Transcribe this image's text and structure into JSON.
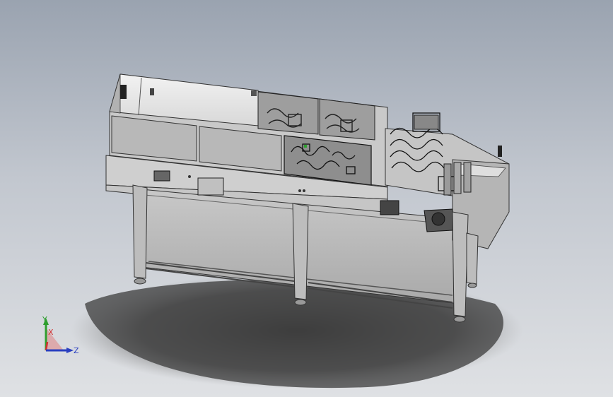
{
  "viewport": {
    "background_top": "#9aa3b0",
    "background_bottom": "#dfe1e4",
    "model_color": "#cfcfcf",
    "panel_color": "#bdbdbd",
    "edge_color": "#3a3a3a"
  },
  "triad": {
    "y_label": "Y",
    "x_label": "X",
    "z_label": "Z",
    "y_color": "#2e9e2e",
    "x_color": "#d03030",
    "z_color": "#2a3fc0"
  }
}
